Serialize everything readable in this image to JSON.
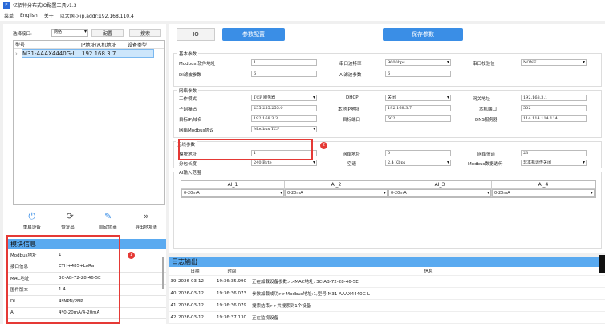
{
  "window": {
    "title": "亿佰特分布式IO配置工具v1.3"
  },
  "menu": {
    "items": [
      "菜单",
      "English",
      "关于"
    ],
    "status": "以太网->ip.addr:192.168.110.4"
  },
  "left": {
    "interface_label": "选择接口:",
    "interface_value": "网络",
    "config_btn": "配置",
    "search_btn": "搜索",
    "columns": [
      "型号",
      "IP地址/从机地址",
      "设备类型"
    ],
    "devices": [
      {
        "model": "M31-AAAX4440G-L",
        "addr": "192.168.3.7",
        "type": ""
      }
    ],
    "tools": [
      {
        "icon": "power-icon",
        "label": "重启设备"
      },
      {
        "icon": "refresh-icon",
        "label": "恢复出厂"
      },
      {
        "icon": "edit-icon",
        "label": "自动协商"
      },
      {
        "icon": "double-chevron-icon",
        "label": "导出地址表"
      }
    ]
  },
  "module_info": {
    "title": "模块信息",
    "rows": [
      [
        "Modbus地址",
        "1"
      ],
      [
        "接口信息",
        "ETH+485+LoRa"
      ],
      [
        "MAC地址",
        "3C-AB-72-28-46-5E"
      ],
      [
        "固件版本",
        "1.4"
      ],
      [
        "DI",
        "4*NPN/PNP"
      ],
      [
        "AI",
        "4*0-20mA/4-20mA"
      ]
    ]
  },
  "top": {
    "io_btn": "IO",
    "param_btn": "参数配置",
    "save_btn": "保存参数"
  },
  "basic": {
    "title": "基本参数",
    "modbus_label": "Modbus 软件地址",
    "modbus": "1",
    "baud_label": "串口波特率",
    "baud": "9600bps",
    "parity_label": "串口校验位",
    "parity": "NONE",
    "di_label": "DI滤波参数",
    "di": "6",
    "ai_label": "AI滤波参数",
    "ai": "6"
  },
  "network": {
    "title": "网络参数",
    "mode_label": "工作模式",
    "mode": "TCP 服务器",
    "dhcp_label": "DHCP",
    "dhcp": "关闭",
    "gw_label": "网关地址",
    "gw": "192.168.3.1",
    "mask_label": "子网掩码",
    "mask": "255.255.255.0",
    "lip_label": "本地IP地址",
    "lip": "192.168.3.7",
    "lport_label": "本机端口",
    "lport": "502",
    "tip_label": "目标IP/域名",
    "tip": "192.168.3.3",
    "tport_label": "目标端口",
    "tport": "502",
    "dns_label": "DNS服务器",
    "dns": "114.114.114.114",
    "proto_label": "网络Modbus协议",
    "proto": "Modbus TCP"
  },
  "wireless": {
    "title": "无线参数",
    "addr_label": "模块地址",
    "addr": "1",
    "net_label": "网络地址",
    "net": "0",
    "ch_label": "网络信道",
    "ch": "23",
    "pkt_label": "分包长度",
    "pkt": "240 Byte",
    "air_label": "空速",
    "air": "2.4 Kbps",
    "trans_label": "Modbus数据透传",
    "trans": "非本机透传关闭"
  },
  "ai_range": {
    "title": "AI输入范围",
    "channels": [
      {
        "name": "AI_1",
        "value": "0-20mA"
      },
      {
        "name": "AI_2",
        "value": "0-20mA"
      },
      {
        "name": "AI_3",
        "value": "0-20mA"
      },
      {
        "name": "AI_4",
        "value": "0-20mA"
      }
    ]
  },
  "log": {
    "title": "日志输出",
    "columns": [
      "日期",
      "时间",
      "信息"
    ],
    "rows": [
      [
        "39",
        "2026-03-12",
        "19:36:35.990",
        "正在加载设备参数>>MAC地址: 3C-AB-72-28-46-5E"
      ],
      [
        "40",
        "2026-03-12",
        "19:36:36.073",
        "参数加载成功>>Modbus地址:1,型号:M31-AAAX4440G-L"
      ],
      [
        "41",
        "2026-03-12",
        "19:36:36.079",
        "搜索结束>>共搜索到1个设备"
      ],
      [
        "42",
        "2026-03-12",
        "19:36:37.130",
        "正在监视设备"
      ]
    ]
  },
  "badges": [
    "1",
    "2"
  ]
}
